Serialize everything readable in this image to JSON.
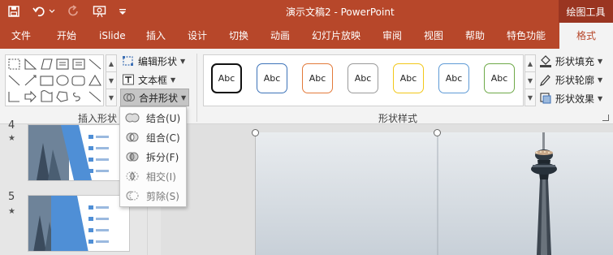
{
  "app": {
    "doc_title": "演示文稿2  -  PowerPoint",
    "context_group": "绘图工具"
  },
  "tabs": [
    "文件",
    "开始",
    "iSlide",
    "插入",
    "设计",
    "切换",
    "动画",
    "幻灯片放映",
    "审阅",
    "视图",
    "帮助",
    "特色功能",
    "格式"
  ],
  "active_tab": "格式",
  "ribbon": {
    "insert_shapes": {
      "label": "插入形状",
      "edit_shape": "编辑形状",
      "text_box": "文本框",
      "merge_shapes": "合并形状"
    },
    "shape_styles": {
      "label": "形状样式",
      "swatch_text": "Abc",
      "swatches": [
        {
          "border": "#111111",
          "width": 2
        },
        {
          "border": "#3d73b9",
          "width": 1
        },
        {
          "border": "#e37a3a",
          "width": 1
        },
        {
          "border": "#9a9a9a",
          "width": 1
        },
        {
          "border": "#f2c718",
          "width": 1
        },
        {
          "border": "#5f9bd6",
          "width": 1
        },
        {
          "border": "#6ea948",
          "width": 1
        }
      ],
      "fill": "形状填充",
      "outline": "形状轮廓",
      "effects": "形状效果"
    }
  },
  "merge_menu": [
    {
      "label": "结合(U)",
      "icon": "union-icon"
    },
    {
      "label": "组合(C)",
      "icon": "combine-icon"
    },
    {
      "label": "拆分(F)",
      "icon": "fragment-icon"
    },
    {
      "label": "相交(I)",
      "icon": "intersect-icon"
    },
    {
      "label": "剪除(S)",
      "icon": "subtract-icon"
    }
  ],
  "slides": [
    {
      "number": "4",
      "star": "★"
    },
    {
      "number": "5",
      "star": "★"
    }
  ],
  "colors": {
    "accent": "#b7472a",
    "context": "#9a3521",
    "slide_blue": "#4f8fd6"
  }
}
